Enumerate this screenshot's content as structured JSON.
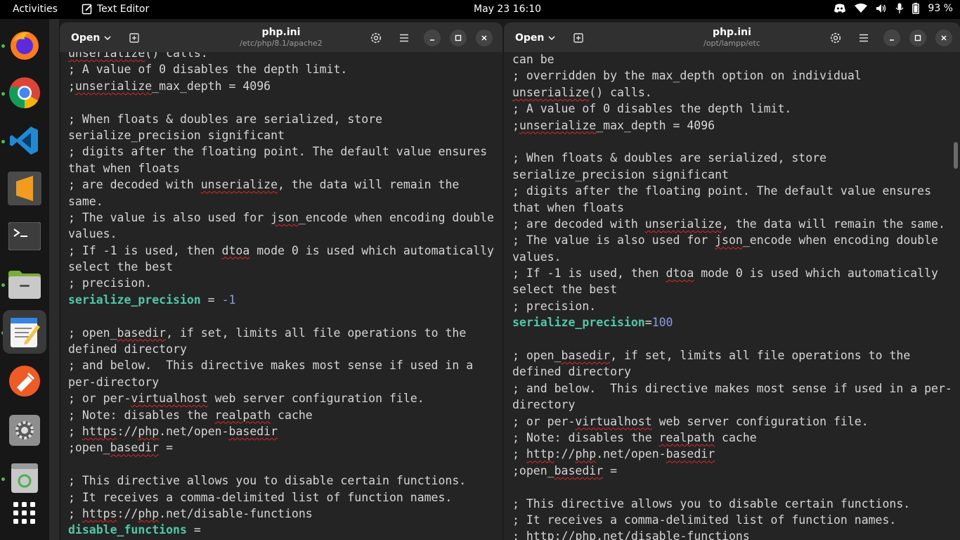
{
  "topbar": {
    "activities": "Activities",
    "app_name": "Text Editor",
    "clock": "May 23  16:10",
    "battery": "93 %"
  },
  "dock": {
    "items": [
      "firefox",
      "chrome",
      "vscode",
      "sublime",
      "terminal",
      "files",
      "text-editor",
      "postman",
      "settings",
      "trash",
      "app-grid"
    ]
  },
  "window_left": {
    "open_label": "Open",
    "title": "php.ini",
    "subtitle": "/etc/php/8.1/apache2",
    "lines": [
      [
        {
          "t": "unserialize",
          "s": "sp"
        },
        {
          "t": "() calls."
        }
      ],
      [
        {
          "t": "; A value of 0 disables the depth limit."
        }
      ],
      [
        {
          "t": ";"
        },
        {
          "t": "unserialize",
          "s": "sp"
        },
        {
          "t": "_max_depth = 4096"
        }
      ],
      [
        {
          "t": ""
        }
      ],
      [
        {
          "t": "; When floats & doubles are serialized, store"
        }
      ],
      [
        {
          "t": "serialize_precision significant"
        }
      ],
      [
        {
          "t": "; digits after the floating point. The default value ensures"
        }
      ],
      [
        {
          "t": "that when floats"
        }
      ],
      [
        {
          "t": "; are decoded with "
        },
        {
          "t": "unserialize",
          "s": "sp"
        },
        {
          "t": ", the data will remain the"
        }
      ],
      [
        {
          "t": "same."
        }
      ],
      [
        {
          "t": "; The value is also used for "
        },
        {
          "t": "json",
          "s": "sp"
        },
        {
          "t": "_encode when encoding double"
        }
      ],
      [
        {
          "t": "values."
        }
      ],
      [
        {
          "t": "; If -1 is used, then "
        },
        {
          "t": "dtoa",
          "s": "sp"
        },
        {
          "t": " mode 0 is used which automatically"
        }
      ],
      [
        {
          "t": "select the best"
        }
      ],
      [
        {
          "t": "; precision."
        }
      ],
      [
        {
          "t": "serialize_precision",
          "s": "key"
        },
        {
          "t": " = "
        },
        {
          "t": "-1",
          "s": "num"
        }
      ],
      [
        {
          "t": ""
        }
      ],
      [
        {
          "t": "; open_"
        },
        {
          "t": "basedir",
          "s": "sp"
        },
        {
          "t": ", if set, limits all file operations to the"
        }
      ],
      [
        {
          "t": "defined directory"
        }
      ],
      [
        {
          "t": "; and below.  This directive makes most sense if used in a"
        }
      ],
      [
        {
          "t": "per-directory"
        }
      ],
      [
        {
          "t": "; or per-"
        },
        {
          "t": "virtualhost",
          "s": "sp"
        },
        {
          "t": " web server configuration file."
        }
      ],
      [
        {
          "t": "; Note: disables the "
        },
        {
          "t": "realpath",
          "s": "sp"
        },
        {
          "t": " cache"
        }
      ],
      [
        {
          "t": "; "
        },
        {
          "t": "https",
          "s": "sp"
        },
        {
          "t": "://"
        },
        {
          "t": "php",
          "s": "sp"
        },
        {
          "t": ".net/open-"
        },
        {
          "t": "basedir",
          "s": "sp"
        }
      ],
      [
        {
          "t": ";open_"
        },
        {
          "t": "basedir",
          "s": "sp"
        },
        {
          "t": " ="
        }
      ],
      [
        {
          "t": ""
        }
      ],
      [
        {
          "t": "; This directive allows you to disable certain functions."
        }
      ],
      [
        {
          "t": "; It receives a comma-delimited list of function names."
        }
      ],
      [
        {
          "t": "; "
        },
        {
          "t": "https",
          "s": "sp"
        },
        {
          "t": "://"
        },
        {
          "t": "php",
          "s": "sp"
        },
        {
          "t": ".net/disable-functions"
        }
      ],
      [
        {
          "t": "disable_functions",
          "s": "key"
        },
        {
          "t": " ="
        }
      ]
    ]
  },
  "window_right": {
    "open_label": "Open",
    "title": "php.ini",
    "subtitle": "/opt/lampp/etc",
    "lines": [
      [
        {
          "t": "can be"
        }
      ],
      [
        {
          "t": "; overridden by the max_depth option on individual"
        }
      ],
      [
        {
          "t": "unserialize",
          "s": "sp"
        },
        {
          "t": "() calls."
        }
      ],
      [
        {
          "t": "; A value of 0 disables the depth limit."
        }
      ],
      [
        {
          "t": ";"
        },
        {
          "t": "unserialize",
          "s": "sp"
        },
        {
          "t": "_max_depth = 4096"
        }
      ],
      [
        {
          "t": ""
        }
      ],
      [
        {
          "t": "; When floats & doubles are serialized, store"
        }
      ],
      [
        {
          "t": "serialize_precision significant"
        }
      ],
      [
        {
          "t": "; digits after the floating point. The default value ensures"
        }
      ],
      [
        {
          "t": "that when floats"
        }
      ],
      [
        {
          "t": "; are decoded with "
        },
        {
          "t": "unserialize",
          "s": "sp"
        },
        {
          "t": ", the data will remain the same."
        }
      ],
      [
        {
          "t": "; The value is also used for "
        },
        {
          "t": "json",
          "s": "sp"
        },
        {
          "t": "_encode when encoding double"
        }
      ],
      [
        {
          "t": "values."
        }
      ],
      [
        {
          "t": "; If -1 is used, then "
        },
        {
          "t": "dtoa",
          "s": "sp"
        },
        {
          "t": " mode 0 is used which automatically"
        }
      ],
      [
        {
          "t": "select the best"
        }
      ],
      [
        {
          "t": "; precision."
        }
      ],
      [
        {
          "t": "serialize_precision",
          "s": "key"
        },
        {
          "t": "="
        },
        {
          "t": "100",
          "s": "num"
        }
      ],
      [
        {
          "t": ""
        }
      ],
      [
        {
          "t": "; open_"
        },
        {
          "t": "basedir",
          "s": "sp"
        },
        {
          "t": ", if set, limits all file operations to the"
        }
      ],
      [
        {
          "t": "defined directory"
        }
      ],
      [
        {
          "t": "; and below.  This directive makes most sense if used in a per-"
        }
      ],
      [
        {
          "t": "directory"
        }
      ],
      [
        {
          "t": "; or per-"
        },
        {
          "t": "virtualhost",
          "s": "sp"
        },
        {
          "t": " web server configuration file."
        }
      ],
      [
        {
          "t": "; Note: disables the "
        },
        {
          "t": "realpath",
          "s": "sp"
        },
        {
          "t": " cache"
        }
      ],
      [
        {
          "t": "; "
        },
        {
          "t": "http",
          "s": "sp"
        },
        {
          "t": "://"
        },
        {
          "t": "php",
          "s": "sp"
        },
        {
          "t": ".net/open-"
        },
        {
          "t": "basedir",
          "s": "sp"
        }
      ],
      [
        {
          "t": ";open_"
        },
        {
          "t": "basedir",
          "s": "sp"
        },
        {
          "t": " ="
        }
      ],
      [
        {
          "t": ""
        }
      ],
      [
        {
          "t": "; This directive allows you to disable certain functions."
        }
      ],
      [
        {
          "t": "; It receives a comma-delimited list of function names."
        }
      ],
      [
        {
          "t": "; "
        },
        {
          "t": "http",
          "s": "sp"
        },
        {
          "t": "://"
        },
        {
          "t": "php",
          "s": "sp"
        },
        {
          "t": ".net/disable-functions"
        }
      ]
    ]
  }
}
